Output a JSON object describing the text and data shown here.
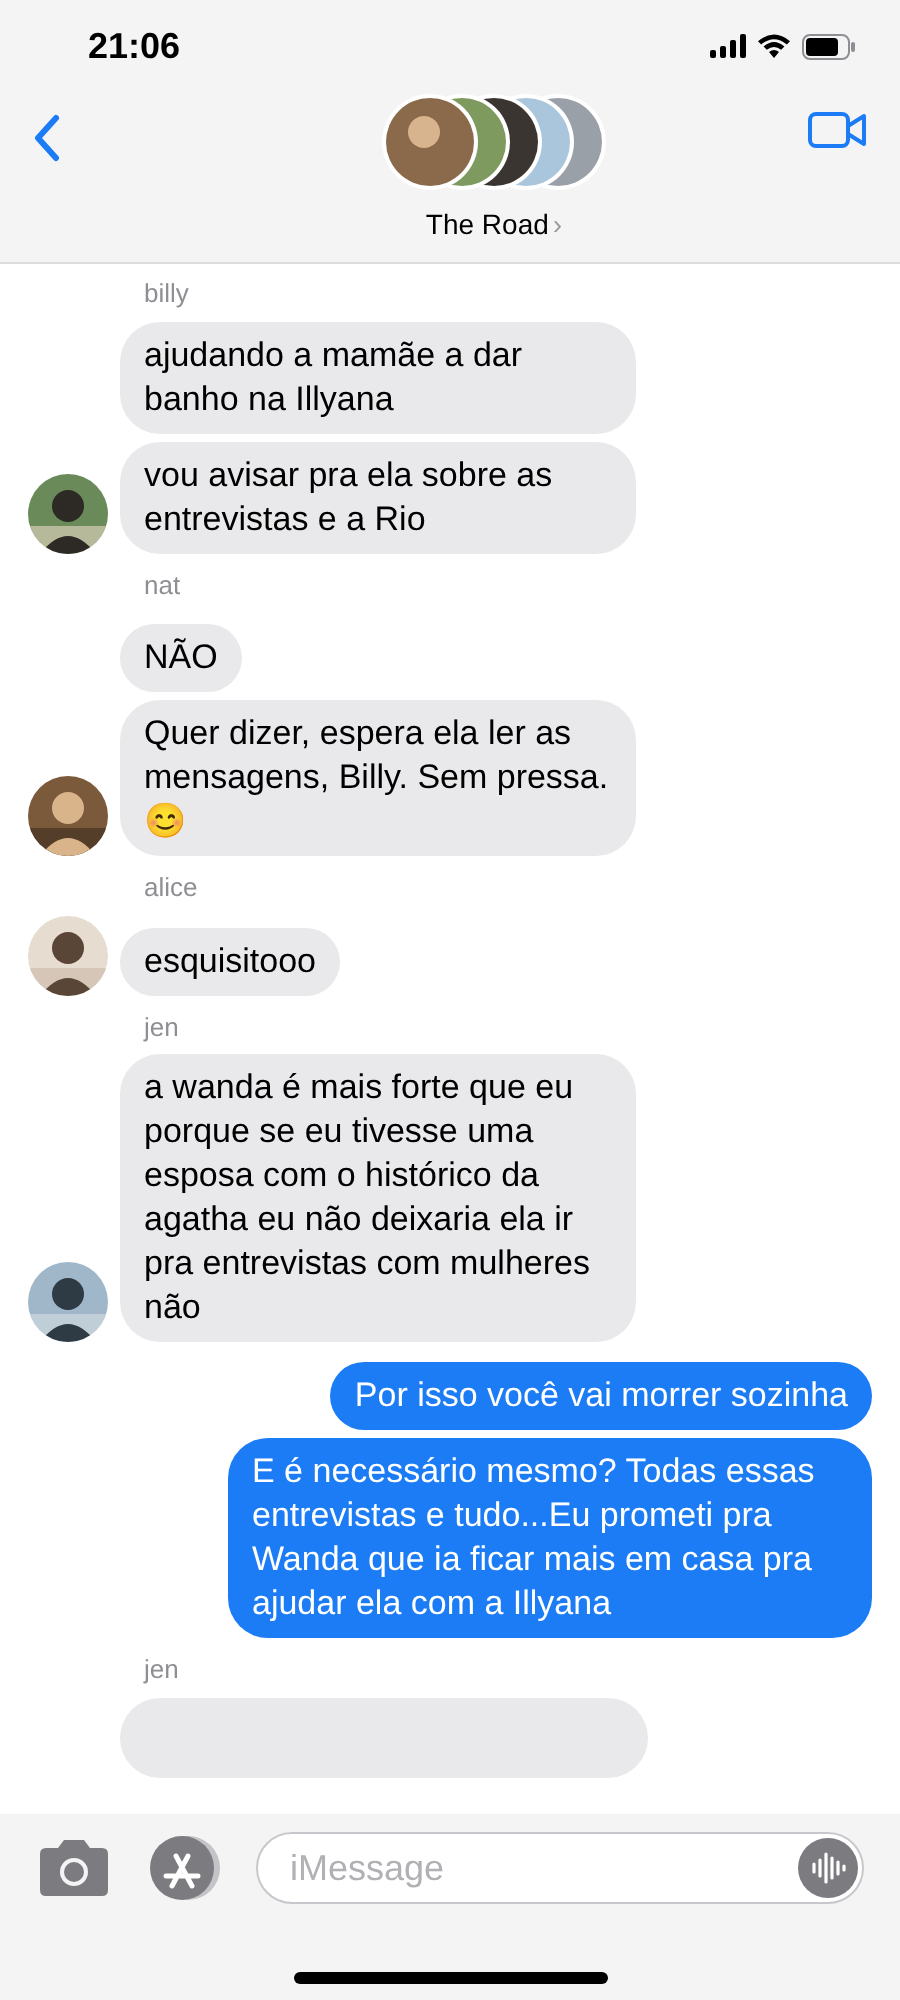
{
  "status_bar": {
    "time": "21:06"
  },
  "header": {
    "title": "The Road",
    "chevron": "›"
  },
  "groups": [
    {
      "kind": "incoming",
      "sender": "billy",
      "avatar": true,
      "messages": [
        "ajudando a mamãe a dar banho na Illyana",
        "vou avisar pra ela sobre as entrevistas e a Rio"
      ]
    },
    {
      "kind": "incoming",
      "sender": "nat",
      "avatar": true,
      "messages": [
        "NÃO",
        "Quer dizer, espera ela ler as mensagens, Billy. Sem pressa. 😊"
      ]
    },
    {
      "kind": "incoming",
      "sender": "alice",
      "avatar": true,
      "messages": [
        "esquisitooo"
      ]
    },
    {
      "kind": "incoming",
      "sender": "jen",
      "avatar": true,
      "messages": [
        "a wanda é mais forte que eu porque se eu tivesse uma esposa com o histórico da agatha eu não deixaria ela ir pra entrevistas com mulheres não"
      ]
    },
    {
      "kind": "outgoing",
      "messages": [
        "Por isso você vai morrer sozinha",
        "E é necessário mesmo? Todas essas entrevistas e tudo...Eu prometi pra Wanda que ia ficar mais em casa pra ajudar ela com a Illyana"
      ]
    },
    {
      "kind": "incoming_cut",
      "sender": "jen"
    }
  ],
  "composer": {
    "placeholder": "iMessage"
  }
}
